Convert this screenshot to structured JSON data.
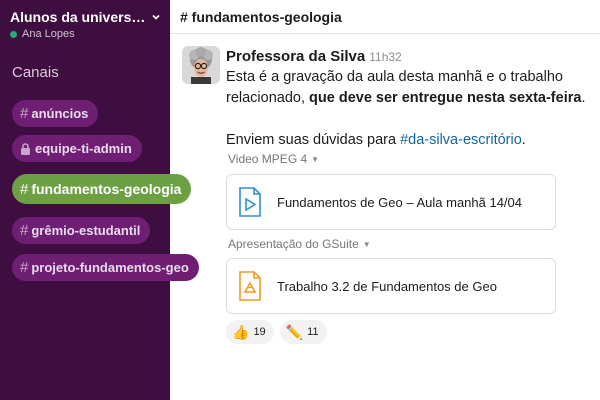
{
  "workspace": {
    "name": "Alunos da universidade",
    "user": "Ana Lopes",
    "presence_color": "#2bac76"
  },
  "sidebar": {
    "section_label": "Canais",
    "channels": [
      {
        "name": "anúncios",
        "prefix": "#",
        "active": false
      },
      {
        "name": "equipe-ti-admin",
        "prefix": "lock-icon",
        "active": false
      },
      {
        "name": "fundamentos-geologia",
        "prefix": "#",
        "active": true
      },
      {
        "name": "grêmio-estudantil",
        "prefix": "#",
        "active": false
      },
      {
        "name": "projeto-fundamentos-geo",
        "prefix": "#",
        "active": false
      }
    ]
  },
  "channel_header": {
    "title": "# fundamentos-geologia"
  },
  "message": {
    "author": "Professora da Silva",
    "time": "11h32",
    "line1": "Esta é a gravação da aula desta manhã e o trabalho",
    "line2_plain": "relacionado, ",
    "line2_bold": "que deve ser entregue nesta sexta-feira",
    "line2_end": ".",
    "line3_plain": "Enviem suas dúvidas para ",
    "line3_link": "#da-silva-escritório",
    "line3_end": "."
  },
  "attachments": [
    {
      "label": "Video MPEG 4",
      "title": "Fundamentos de Geo – Aula manhã 14/04",
      "icon": "video-file-icon",
      "color": "#2e8fd6"
    },
    {
      "label": "Apresentação do GSuite",
      "title": "Trabalho 3.2 de Fundamentos de Geo",
      "icon": "slides-file-icon",
      "color": "#f29b1d"
    }
  ],
  "reactions": [
    {
      "emoji": "👍",
      "count": "19",
      "icon": "thumbs-up-icon"
    },
    {
      "emoji": "✏️",
      "count": "11",
      "icon": "pencil-icon"
    }
  ],
  "colors": {
    "sidebar_bg": "#3f0e40",
    "pill_bg": "#6f1f73",
    "active_pill": "#6ca043",
    "link": "#1264a3"
  }
}
